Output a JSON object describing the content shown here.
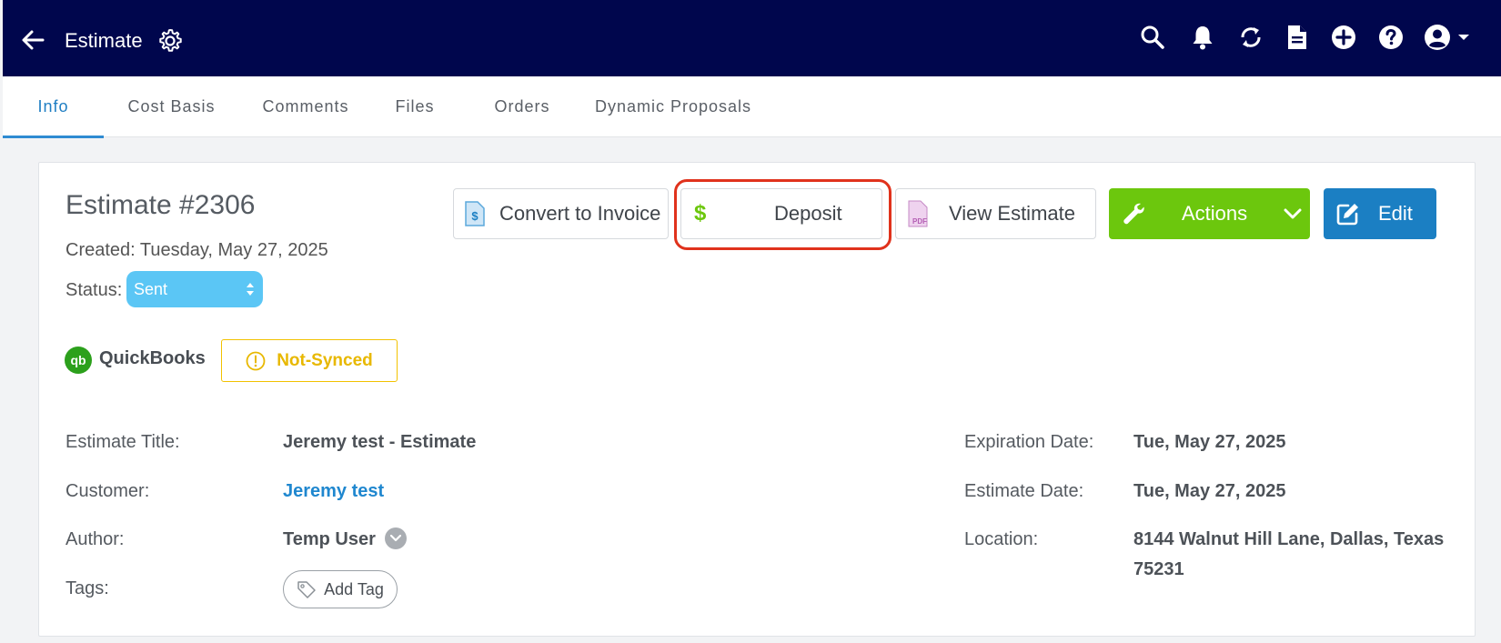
{
  "header": {
    "title": "Estimate",
    "back_icon": "arrow-left-icon",
    "settings_icon": "gear-icon",
    "icons": [
      "search-icon",
      "bell-icon",
      "sync-icon",
      "document-icon",
      "plus-circle-icon",
      "help-icon",
      "user-account-icon"
    ]
  },
  "tabs": [
    {
      "label": "Info",
      "active": true
    },
    {
      "label": "Cost Basis"
    },
    {
      "label": "Comments"
    },
    {
      "label": "Files"
    },
    {
      "label": "Orders"
    },
    {
      "label": "Dynamic Proposals"
    }
  ],
  "estimate": {
    "number": "Estimate #2306",
    "created": "Created: Tuesday, May 27, 2025",
    "status_label": "Status:",
    "status_value": "Sent"
  },
  "buttons": {
    "convert": "Convert to Invoice",
    "deposit": "Deposit",
    "view": "View Estimate",
    "actions": "Actions",
    "edit": "Edit"
  },
  "quickbooks": {
    "label": "QuickBooks",
    "logo_text": "qb",
    "sync_status": "Not-Synced"
  },
  "fields": {
    "estimate_title_label": "Estimate Title:",
    "estimate_title_value": "Jeremy test - Estimate",
    "customer_label": "Customer:",
    "customer_value": "Jeremy test",
    "author_label": "Author:",
    "author_value": "Temp User",
    "tags_label": "Tags:",
    "add_tag": "Add Tag",
    "expiration_label": "Expiration Date:",
    "expiration_value": "Tue, May 27, 2025",
    "estimate_date_label": "Estimate Date:",
    "estimate_date_value": "Tue, May 27, 2025",
    "location_label": "Location:",
    "location_line1": "8144 Walnut Hill Lane, Dallas, Texas",
    "location_line2": "75231"
  },
  "colors": {
    "header_bg": "#00064d",
    "accent_blue": "#1b7fc3",
    "actions_green": "#6cc70d",
    "status_blue": "#5bc6f5",
    "sync_yellow": "#f2c200",
    "highlight_red": "#e0321c"
  }
}
